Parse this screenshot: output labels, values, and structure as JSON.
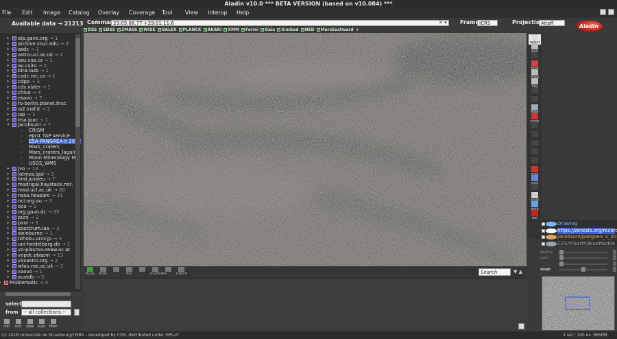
{
  "window": {
    "title": "Aladin v10.0    *** BETA VERSION (based on v10.084) ***"
  },
  "menu": [
    "File",
    "Edit",
    "Image",
    "Catalog",
    "Overlay",
    "Coverage",
    "Tool",
    "View",
    "Interop",
    "Help"
  ],
  "available_data": "Available data → 21213 / 212",
  "command": {
    "label": "Command",
    "value": "23:05:08.77 +29:01:11.6"
  },
  "frame": {
    "label": "Frame",
    "value": "ICRS"
  },
  "projection": {
    "label": "Projection",
    "value": "Aitoff"
  },
  "logo_text": "Aladin",
  "surveys": [
    "DSS",
    "SDSS",
    "2MASS",
    "WISE",
    "GALEX",
    "PLANCK",
    "AKARI",
    "XMM",
    "Fermi",
    "Gaia",
    "Simbad",
    "NED",
    "MarsEastward"
  ],
  "surveys_add": "+",
  "tree": [
    {
      "t": "f",
      "label": "aip.gavo.org",
      "cnt": " → 1"
    },
    {
      "t": "f",
      "label": "archive.stsci.edu",
      "cnt": " → 3"
    },
    {
      "t": "f",
      "label": "asdc",
      "cnt": " → 1"
    },
    {
      "t": "f",
      "label": "astro.ucl.ac.uk",
      "cnt": " → 2"
    },
    {
      "t": "f",
      "label": "asu.cas.cz",
      "cnt": " → 1"
    },
    {
      "t": "f",
      "label": "au.csiro",
      "cnt": " → 2"
    },
    {
      "t": "f",
      "label": "bira-iasb",
      "cnt": " → 1"
    },
    {
      "t": "f",
      "label": "cadc.nrc.ca",
      "cnt": " → 1"
    },
    {
      "t": "f",
      "label": "cdpp",
      "cnt": " → 3"
    },
    {
      "t": "f",
      "label": "cds.vizier",
      "cnt": " → 1"
    },
    {
      "t": "f",
      "label": "chivo",
      "cnt": " → 4"
    },
    {
      "t": "f",
      "label": "esavo",
      "cnt": " → 7"
    },
    {
      "t": "f",
      "label": "fu-berlin.planet.hrsc",
      "cnt": ""
    },
    {
      "t": "f",
      "label": "ia2.inaf.it",
      "cnt": " → 2"
    },
    {
      "t": "f",
      "label": "iap",
      "cnt": " → 1"
    },
    {
      "t": "f",
      "label": "irsa.ipac",
      "cnt": " → 1"
    },
    {
      "t": "o",
      "label": "jacobsuni",
      "cnt": " → 7"
    },
    {
      "t": "l",
      "label": "CRISM",
      "cnt": ""
    },
    {
      "t": "l",
      "label": "epn1 TAP service",
      "cnt": ""
    },
    {
      "t": "l",
      "label": "ESA PANGAEA-X 2017",
      "cnt": "",
      "sel": true
    },
    {
      "t": "l",
      "label": "Mars_craters",
      "cnt": ""
    },
    {
      "t": "l",
      "label": "Mars_craters_lagaln",
      "cnt": ""
    },
    {
      "t": "l",
      "label": "Moon Mineralogy Ma",
      "cnt": ""
    },
    {
      "t": "l",
      "label": "USGS_WMS",
      "cnt": ""
    },
    {
      "t": "f",
      "label": "jvo",
      "cnt": " → 13"
    },
    {
      "t": "f",
      "label": "latmos.ipsl",
      "cnt": " → 3"
    },
    {
      "t": "f",
      "label": "lmd.jussieu",
      "cnt": " → 7"
    },
    {
      "t": "f",
      "label": "madrigal.haystack.mit.",
      "cnt": ""
    },
    {
      "t": "f",
      "label": "mssl.ucl.ac.uk",
      "cnt": " → 30"
    },
    {
      "t": "f",
      "label": "nasa.heasarc",
      "cnt": " → 31"
    },
    {
      "t": "f",
      "label": "nci.org.au",
      "cnt": " → 3"
    },
    {
      "t": "f",
      "label": "oca",
      "cnt": " → 1"
    },
    {
      "t": "f",
      "label": "org.gavo.dc",
      "cnt": " → 35"
    },
    {
      "t": "f",
      "label": "purx",
      "cnt": " → 2"
    },
    {
      "t": "f",
      "label": "pvol",
      "cnt": " → 3"
    },
    {
      "t": "f",
      "label": "spectrum.iaa",
      "cnt": " → 3"
    },
    {
      "t": "f",
      "label": "swinburne",
      "cnt": " → 1"
    },
    {
      "t": "f",
      "label": "tohoku.univ.jp",
      "cnt": " → 3"
    },
    {
      "t": "f",
      "label": "uni-heidelberg.de",
      "cnt": " → 1"
    },
    {
      "t": "f",
      "label": "vo-plasma.oeaw.ac.at",
      "cnt": ""
    },
    {
      "t": "f",
      "label": "vopdc.obspm",
      "cnt": " → 13"
    },
    {
      "t": "f",
      "label": "voxastro.org",
      "cnt": " → 2"
    },
    {
      "t": "f",
      "label": "wfau.roe.ac.uk",
      "cnt": " → 2"
    },
    {
      "t": "f",
      "label": "xaovo",
      "cnt": " → 1"
    },
    {
      "t": "f",
      "label": "xcatdb",
      "cnt": " → 2"
    },
    {
      "t": "p",
      "label": "Problematic",
      "cnt": " → 4"
    }
  ],
  "select_label": "select",
  "from_label": "from",
  "from_value": "-- all collections --",
  "left_tools": [
    "coll",
    "sort",
    "view",
    "scan",
    "filter"
  ],
  "view_tools": [
    "study",
    "wink",
    "",
    "full",
    "",
    "multiview",
    "",
    "match"
  ],
  "search_placeholder": "Search",
  "right_tools": [
    "select",
    "pan",
    "",
    "phot",
    "draw",
    "tag",
    "",
    "",
    "filter",
    "cross",
    "",
    "",
    "",
    "",
    "",
    "crop",
    "cont",
    "",
    "pixel",
    "prop",
    "del"
  ],
  "layers": [
    {
      "name": "Drawing",
      "color": "#7ab8ff"
    },
    {
      "name": "https://zenodo.org/record/...",
      "color": "#ffffff",
      "selected": true
    },
    {
      "name": "jacobsuni/pangaea_x_2017/c",
      "color": "#d8a869"
    },
    {
      "name": "CDS/P/Earth/BlueMarble",
      "color": "#9aa3ad"
    }
  ],
  "sliders": [
    "opacity",
    "color",
    "",
    "zoom"
  ],
  "status": {
    "left": "(c) 2018 Université de Strasbourg/CNRS - developed by CDS, distributed under GPLv3",
    "right": "2 sel / 100 ev.     965MB"
  }
}
